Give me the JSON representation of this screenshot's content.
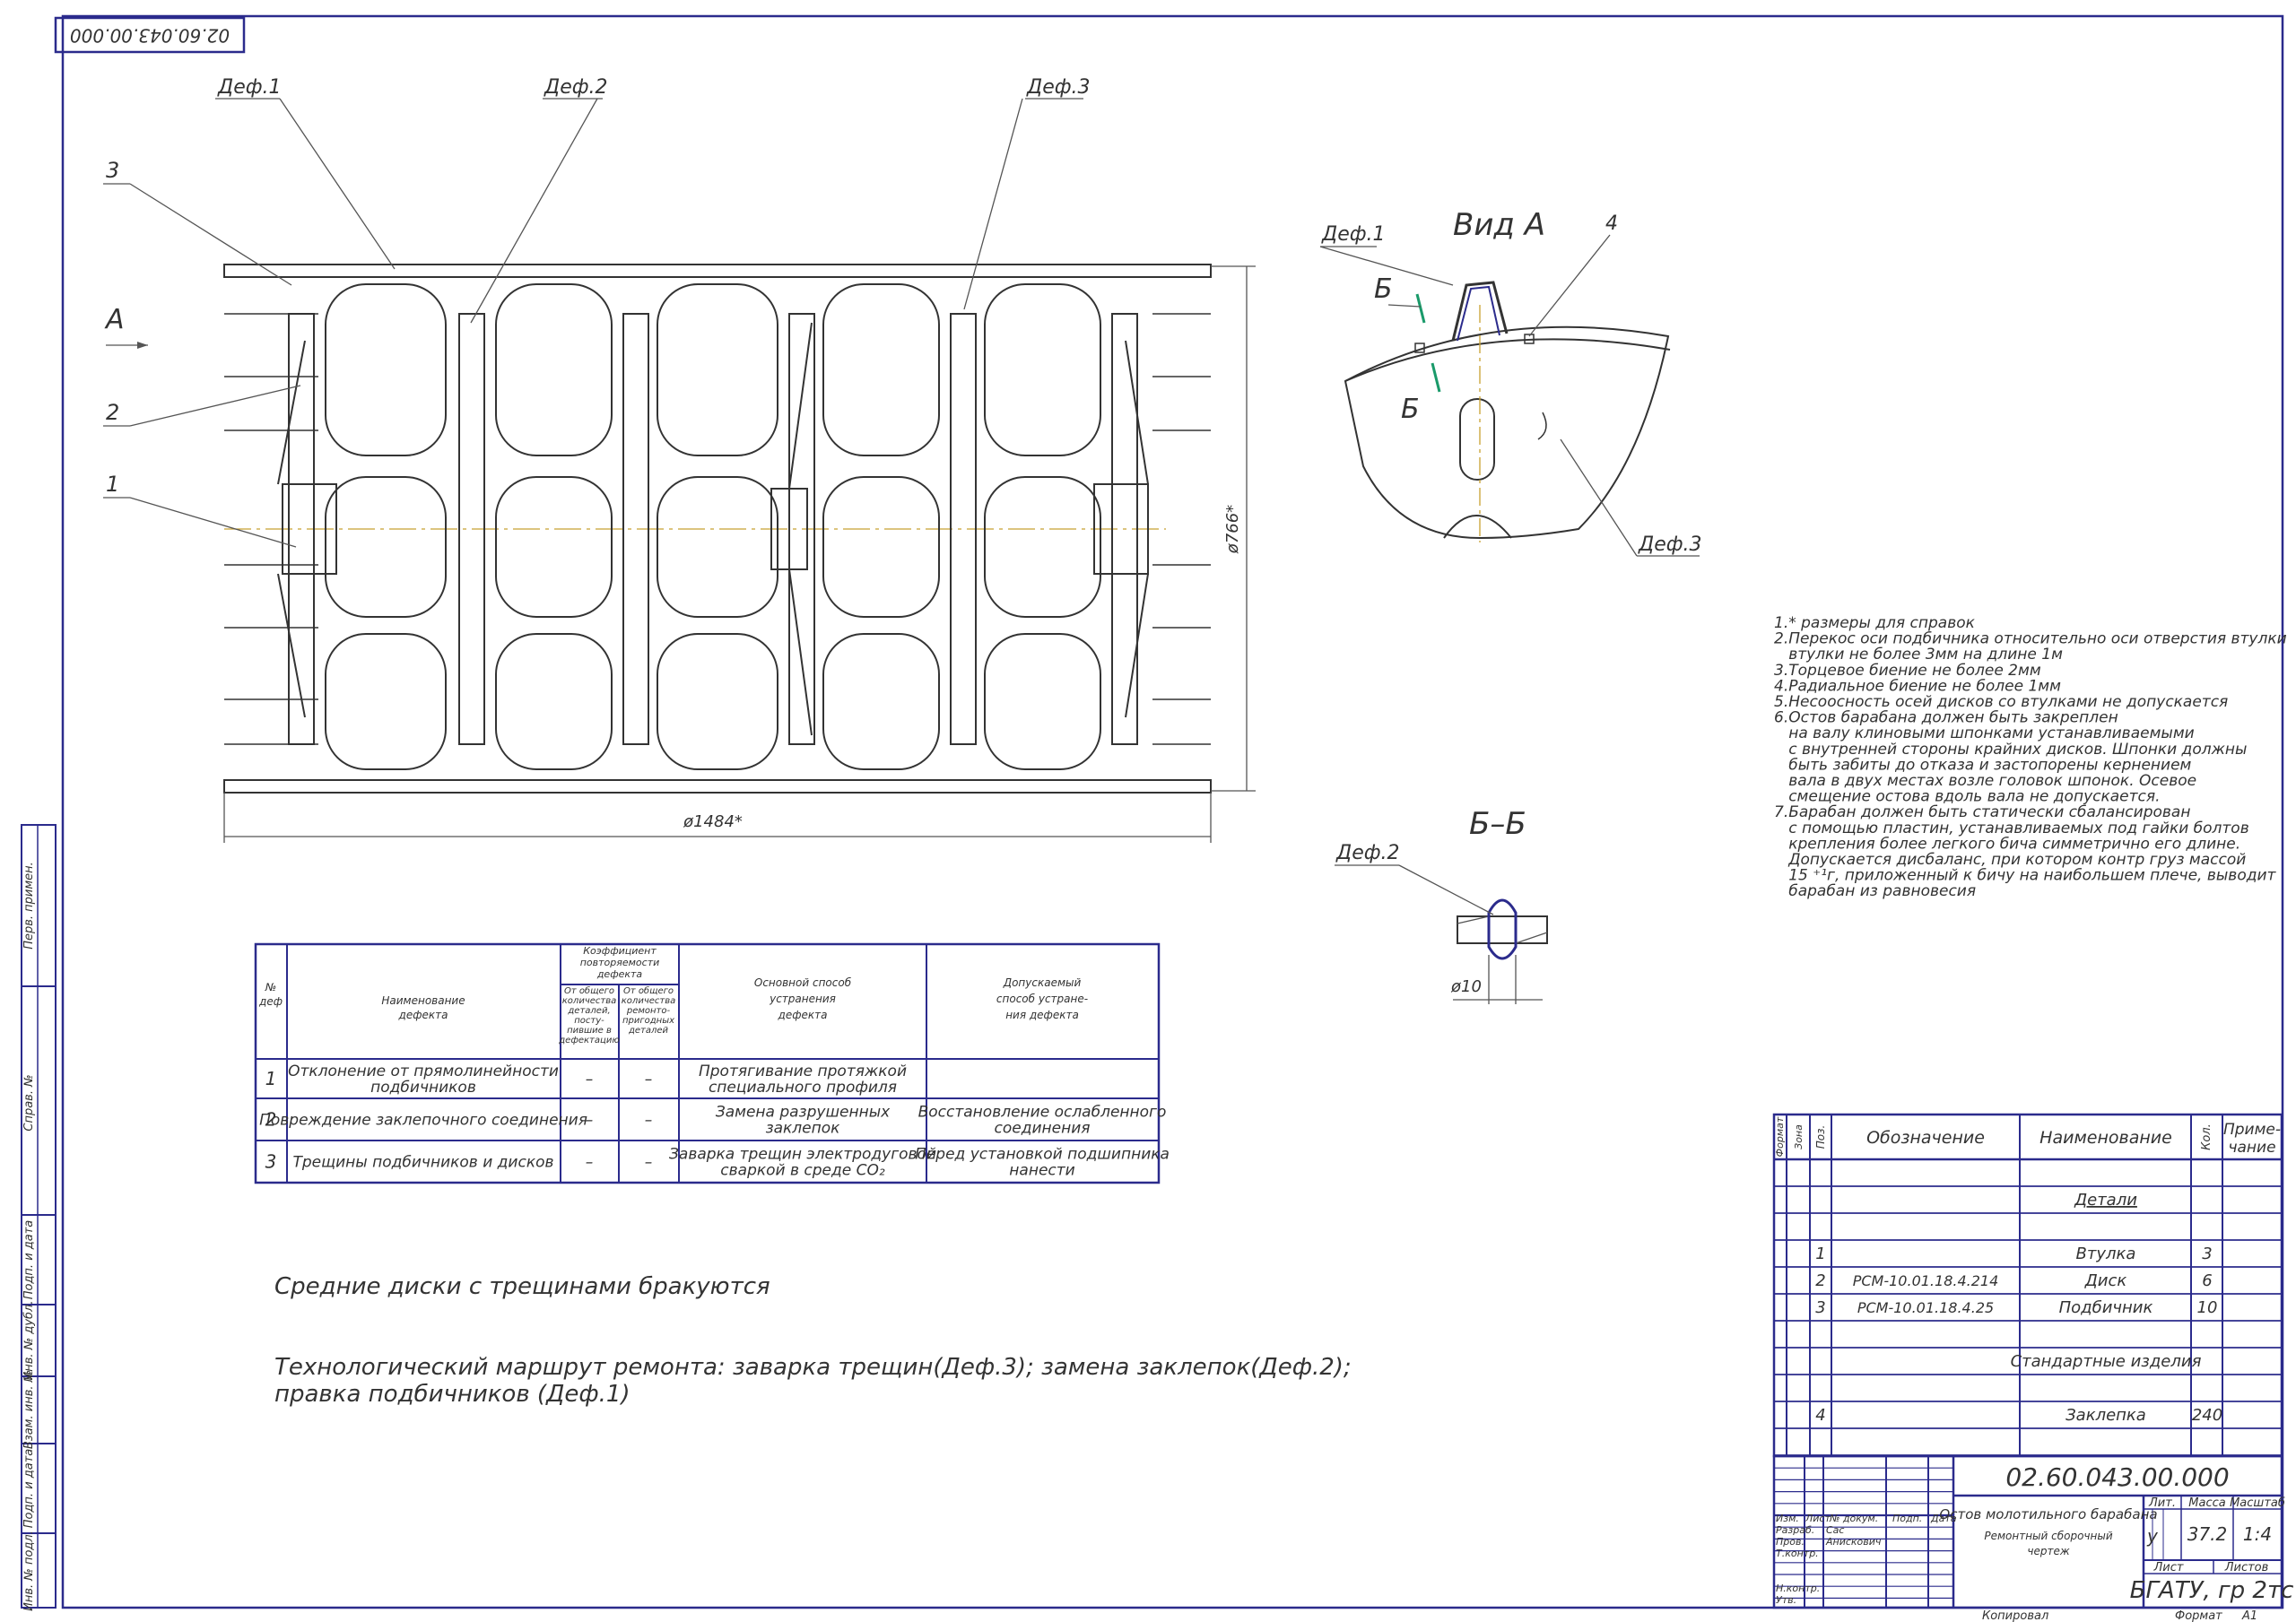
{
  "stamp_top": "02.60.043.00.000",
  "leaders_left": {
    "def1": "Деф.1",
    "def2": "Деф.2",
    "def3": "Деф.3",
    "pos3": "3",
    "pos2": "2",
    "pos1": "1",
    "view_mark": "А"
  },
  "dims": {
    "diameter": "ø766*",
    "length": "ø1484*",
    "hole": "ø10"
  },
  "view_a": {
    "title": "Вид А",
    "def1": "Деф.1",
    "pos4": "4",
    "def3": "Деф.3",
    "cut_top": "Б",
    "cut_bottom": "Б"
  },
  "section_bb": {
    "title": "Б–Б",
    "def2": "Деф.2"
  },
  "notes": [
    "1.* размеры для справок",
    "2.Перекос оси подбичника относительно оси отверстия втулки",
    "   втулки не более 3мм на длине 1м",
    "3.Торцевое биение не более 2мм",
    "4.Радиальное биение не более 1мм",
    "5.Несоосность осей дисков со втулками не допускается",
    "6.Остов барабана должен быть закреплен",
    "   на валу клиновыми шпонками устанавливаемыми",
    "   с внутренней стороны крайних дисков. Шпонки должны",
    "   быть забиты до отказа и застопорены кернением",
    "   вала в двух местах возле головок шпонок. Осевое",
    "   смещение остова вдоль вала не допускается.",
    "7.Барабан должен быть статически сбалансирован",
    "   с помощью пластин, устанавливаемых под гайки болтов",
    "   крепления более легкого бича симметрично его длине.",
    "   Допускается дисбаланс, при котором контр груз массой",
    "   15 ⁺¹г, приложенный к бичу на наибольшем плече, выводит",
    "   барабан из равновесия"
  ],
  "defect_table": {
    "headers": {
      "no": [
        "№",
        "деф"
      ],
      "name": [
        "Наименование",
        "дефекта"
      ],
      "coef": [
        "Коэффициент",
        "повторяемости",
        "дефекта"
      ],
      "coef_a": [
        "От общего",
        "количества",
        "деталей,",
        "посту-",
        "пившие в",
        "дефектацию"
      ],
      "coef_b": [
        "От общего",
        "количества",
        "ремонто-",
        "пригодных",
        "деталей"
      ],
      "method": [
        "Основной способ",
        "устранения",
        "дефекта"
      ],
      "allowed": [
        "Допускаемый",
        "способ устране-",
        "ния дефекта"
      ]
    },
    "rows": [
      {
        "no": "1",
        "name": [
          "Отклонение от прямолинейности",
          "подбичников"
        ],
        "a": "–",
        "b": "–",
        "method": [
          "Протягивание протяжкой",
          "специального профиля"
        ],
        "allowed": []
      },
      {
        "no": "2",
        "name": [
          "Повреждение заклепочного соединения"
        ],
        "a": "–",
        "b": "–",
        "method": [
          "Замена разрушенных",
          "заклепок"
        ],
        "allowed": [
          "Восстановление ослабленного",
          "соединения"
        ]
      },
      {
        "no": "3",
        "name": [
          "Трещины подбичников и дисков"
        ],
        "a": "–",
        "b": "–",
        "method": [
          "Заварка трещин электродуговой",
          "сваркой в среде CO₂"
        ],
        "allowed": [
          "Перед установкой подшипника",
          "нанести"
        ]
      }
    ]
  },
  "remark1": "Средние диски с трещинами бракуются",
  "remark2a": "Технологический маршрут ремонта: заварка трещин(Деф.3); замена заклепок(Деф.2);",
  "remark2b": "правка подбичников (Деф.1)",
  "spec": {
    "headers": {
      "format": "Формат",
      "zone": "Зона",
      "pos": "Поз.",
      "designation": "Обозначение",
      "name": "Наименование",
      "qty": "Кол.",
      "note": "Приме-",
      "note2": "чание"
    },
    "section_parts": "Детали",
    "rows": [
      {
        "pos": "1",
        "designation": "",
        "name": "Втулка",
        "qty": "3"
      },
      {
        "pos": "2",
        "designation": "РСМ-10.01.18.4.214",
        "name": "Диск",
        "qty": "6"
      },
      {
        "pos": "3",
        "designation": "РСМ-10.01.18.4.25",
        "name": "Подбичник",
        "qty": "10"
      }
    ],
    "section_std": "Стандартные изделия",
    "std_rows": [
      {
        "pos": "4",
        "name": "Заклепка",
        "qty": "240"
      }
    ]
  },
  "title_block": {
    "designation": "02.60.043.00.000",
    "name_line1": "Остов молотильного барабана",
    "name_line2": "Ремонтный сборочный",
    "name_line3": "чертеж",
    "lit_label": "Лит.",
    "mass_label": "Масса",
    "scale_label": "Масштаб",
    "lit": "у",
    "mass": "37.2",
    "scale": "1:4",
    "sheet_label": "Лист",
    "sheets_label": "Листов",
    "org": "БГАТУ, гр 2тс",
    "rows": [
      "Изм.",
      "Лист",
      "№ докум.",
      "Подп.",
      "Дата"
    ],
    "role_razrab": "Разраб.",
    "name_razrab": "Сас",
    "role_prov": "Пров.",
    "name_prov": "Анискович",
    "role_tkontr": "Т.контр.",
    "role_nkontr": "Н.контр.",
    "role_utv": "Утв.",
    "copied": "Копировал",
    "format": "Формат",
    "format_val": "А1"
  },
  "side_strip": [
    "Перв. примен.",
    "Справ. №",
    "Подп. и дата",
    "Инв. № дубл.",
    "Взам. инв. №",
    "Подп. и дата",
    "Инв. № подл."
  ]
}
